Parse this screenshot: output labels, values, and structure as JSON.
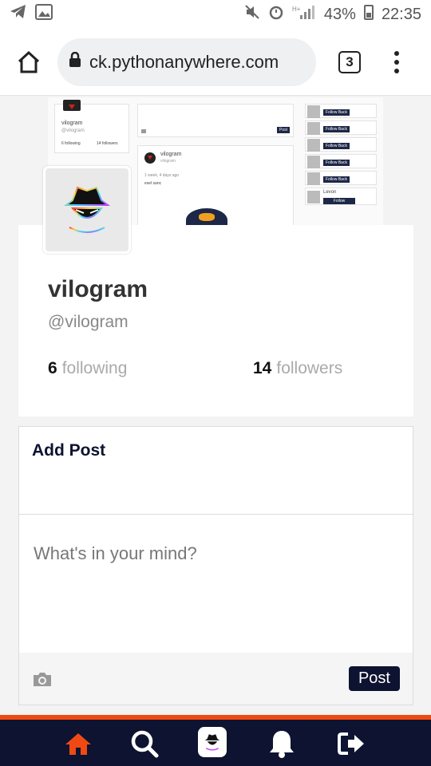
{
  "status_bar": {
    "battery": "43%",
    "time": "22:35"
  },
  "browser": {
    "url": "ck.pythonanywhere.com",
    "tab_count": "3"
  },
  "cover": {
    "mini_username": "vilogram",
    "mini_handle": "@vilogram",
    "mini_following": "6 following",
    "mini_followers": "14 followers",
    "mini_post_author": "vilogram",
    "mini_post_handle": "vilogram",
    "mini_post_time": "1 week, 4 days ago",
    "mini_post_text": "esel sanc",
    "mini_post_button": "Post",
    "follow_back_label": "Follow Back",
    "follow_label": "Follow",
    "suggested_user": "Levon"
  },
  "profile": {
    "name": "vilogram",
    "handle": "@vilogram",
    "following_count": "6",
    "following_label": "following",
    "followers_count": "14",
    "followers_label": "followers"
  },
  "add_post": {
    "title": "Add Post",
    "placeholder": "What's in your mind?",
    "post_button": "Post"
  },
  "bottom_nav": {
    "items": [
      "home-icon",
      "search-icon",
      "profile-avatar",
      "bell-icon",
      "logout-icon"
    ],
    "active_color": "#f04a14"
  },
  "colors": {
    "brand_dark": "#0d1330",
    "accent": "#f04a14"
  }
}
